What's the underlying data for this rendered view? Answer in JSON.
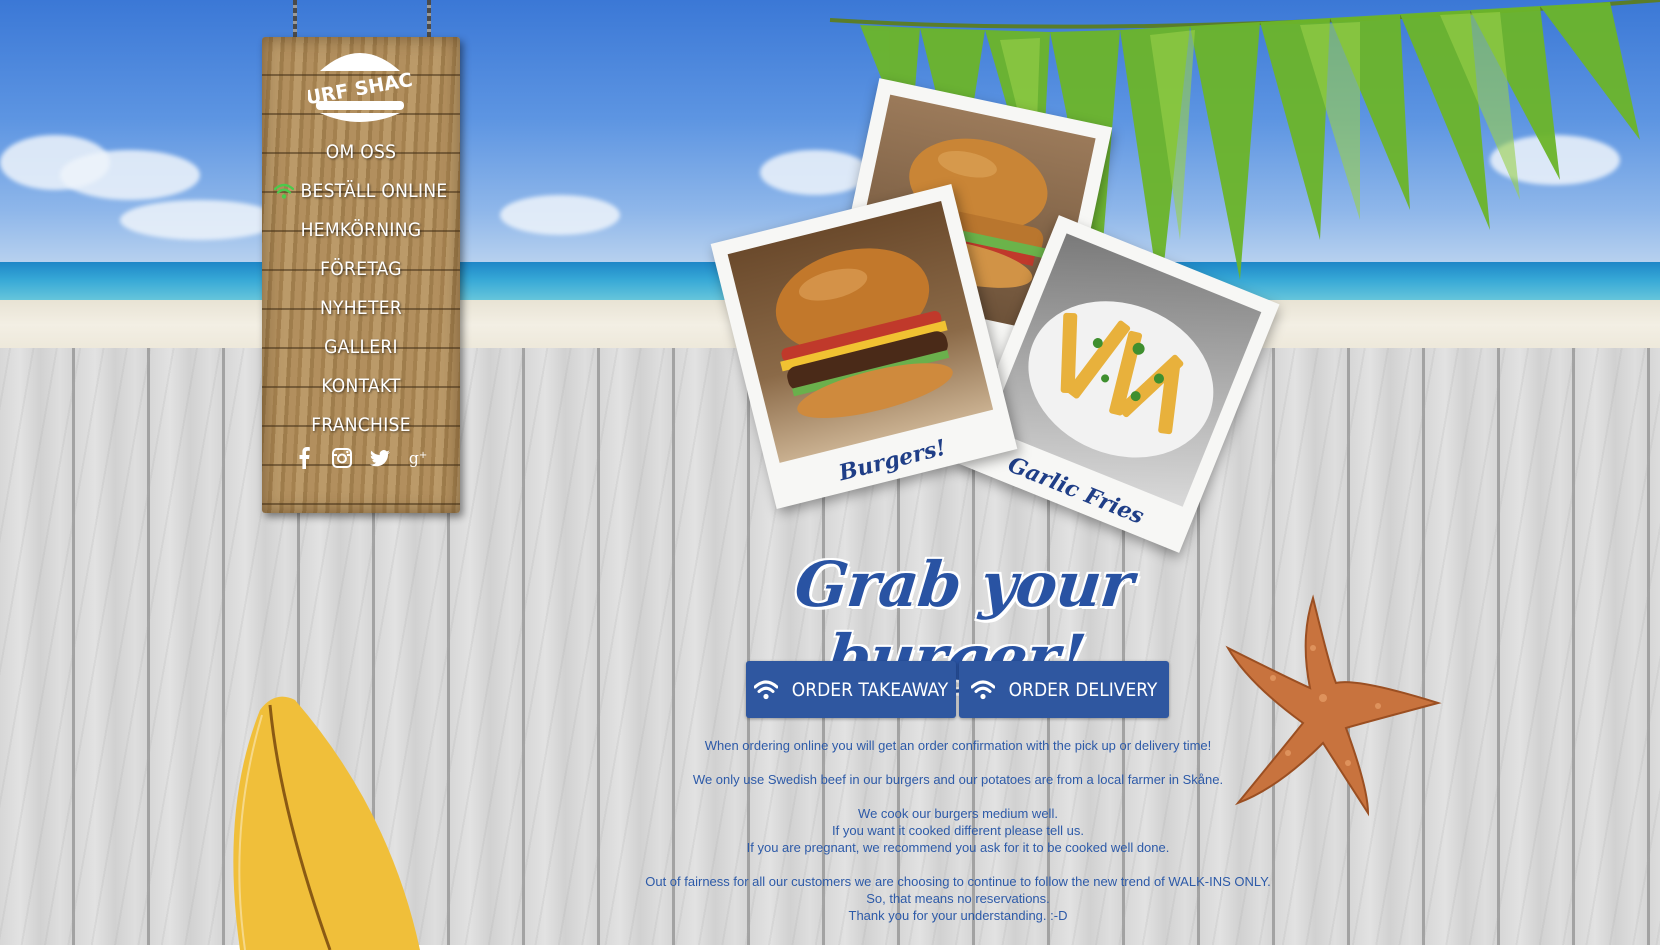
{
  "brand": {
    "logo_text": "SURF SHACK"
  },
  "nav": {
    "items": [
      {
        "label": "OM OSS",
        "icon": ""
      },
      {
        "label": "BESTÄLL ONLINE",
        "icon": "wifi-icon"
      },
      {
        "label": "HEMKÖRNING",
        "icon": ""
      },
      {
        "label": "FÖRETAG",
        "icon": ""
      },
      {
        "label": "NYHETER",
        "icon": ""
      },
      {
        "label": "GALLERI",
        "icon": ""
      },
      {
        "label": "KONTAKT",
        "icon": ""
      },
      {
        "label": "FRANCHISE",
        "icon": ""
      }
    ],
    "social": [
      "facebook-icon",
      "instagram-icon",
      "twitter-icon",
      "google-plus-icon"
    ]
  },
  "polaroids": [
    {
      "caption": ""
    },
    {
      "caption": "Burgers!"
    },
    {
      "caption": "Garlic Fries"
    }
  ],
  "main": {
    "headline": "Grab your burger!",
    "buttons": {
      "takeaway": "ORDER TAKEAWAY",
      "delivery": "ORDER DELIVERY"
    },
    "info": {
      "line1": "When ordering online you will get an order confirmation with the pick up or delivery time!",
      "line2": "We only use Swedish beef in our burgers and our potatoes are from a local farmer in Skåne.",
      "line3": "We cook our burgers medium well.",
      "line4": "If you want it cooked different please tell us.",
      "line5": "If you are pregnant, we recommend you ask for it to be cooked well done.",
      "line6": "Out of fairness for all our customers we are choosing to continue to follow the new trend of WALK-INS ONLY.",
      "line7": "So, that means no reservations.",
      "line8": "Thank you for your understanding. :-D"
    }
  },
  "colors": {
    "accent": "#2f57a0",
    "text_blue": "#2d5aa8",
    "wifi_green": "#4cc94c"
  }
}
